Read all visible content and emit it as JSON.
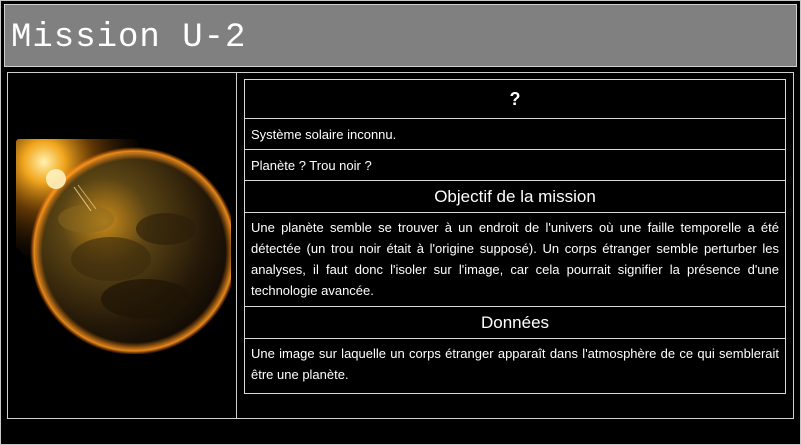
{
  "header": {
    "title": "Mission U-2"
  },
  "image": {
    "alt": "planet-image",
    "colors": {
      "glow": "#ffb020",
      "surface_dark": "#1a1206",
      "surface_mid": "#5a4414"
    }
  },
  "info": {
    "heading": "?",
    "line1": "Système solaire inconnu.",
    "line2": "Planète ? Trou noir ?",
    "objective_heading": "Objectif de la mission",
    "objective_text": "Une planète semble se trouver à un endroit de l'univers où une faille temporelle a été détectée (un trou noir était à l'origine supposé). Un corps étranger semble perturber les analyses, il faut donc l'isoler sur l'image, car cela pourrait signifier la présence d'une technologie avancée.",
    "data_heading": "Données",
    "data_text": "Une image sur laquelle un corps étranger apparaît dans l'atmosphère de ce qui semblerait être une planète."
  },
  "colors": {
    "background": "#000000",
    "header_bg": "#808080",
    "border": "#d0d0d0",
    "text": "#ffffff"
  }
}
